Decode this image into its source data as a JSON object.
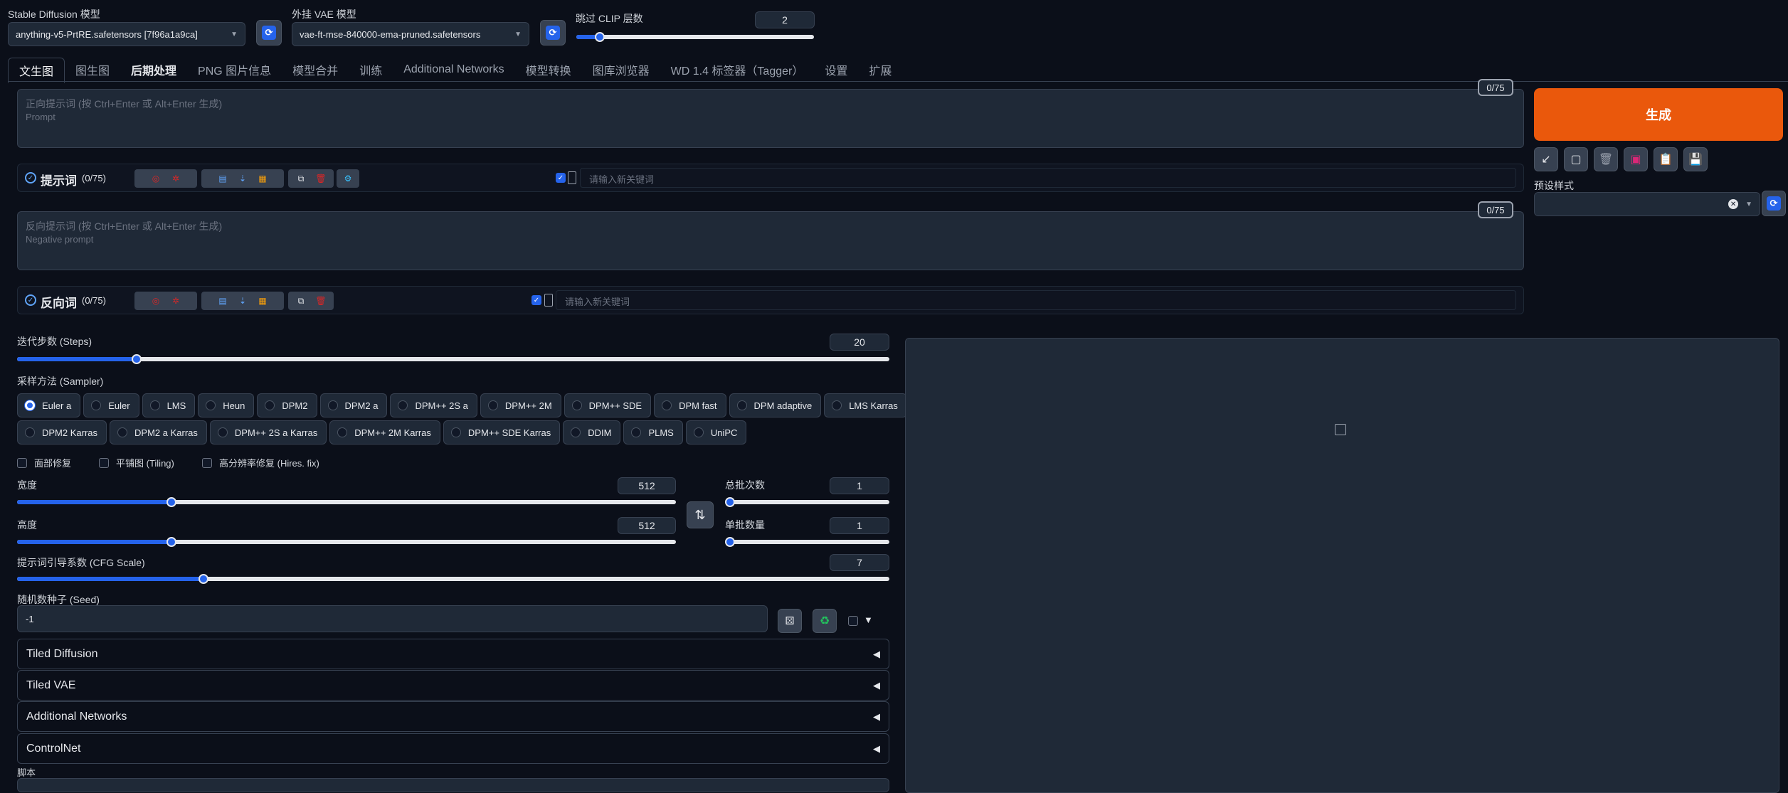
{
  "top": {
    "sd_model_label": "Stable Diffusion 模型",
    "sd_model_value": "anything-v5-PrtRE.safetensors [7f96a1a9ca]",
    "vae_label": "外挂 VAE 模型",
    "vae_value": "vae-ft-mse-840000-ema-pruned.safetensors",
    "clip_label": "跳过 CLIP 层数",
    "clip_value": "2",
    "clip_fraction": 0.08
  },
  "tabs": [
    "文生图",
    "图生图",
    "后期处理",
    "PNG 图片信息",
    "模型合并",
    "训练",
    "Additional Networks",
    "模型转换",
    "图库浏览器",
    "WD 1.4 标签器（Tagger）",
    "设置",
    "扩展"
  ],
  "prompt": {
    "counter": "0/75",
    "placeholder_line1": "正向提示词 (按 Ctrl+Enter 或 Alt+Enter 生成)",
    "placeholder_line2": "Prompt"
  },
  "prompt_tags": {
    "title": "提示词",
    "count": "(0/75)",
    "keyword_placeholder": "请输入新关键词"
  },
  "negative": {
    "counter": "0/75",
    "placeholder_line1": "反向提示词 (按 Ctrl+Enter 或 Alt+Enter 生成)",
    "placeholder_line2": "Negative prompt"
  },
  "negative_tags": {
    "title": "反向词",
    "count": "(0/75)",
    "keyword_placeholder": "请输入新关键词"
  },
  "generate": {
    "label": "生成",
    "preset_label": "预设样式"
  },
  "steps": {
    "label": "迭代步数 (Steps)",
    "value": "20",
    "fraction": 0.133
  },
  "sampler": {
    "label": "采样方法 (Sampler)",
    "selected": "Euler a",
    "row1": [
      "Euler a",
      "Euler",
      "LMS",
      "Heun",
      "DPM2",
      "DPM2 a",
      "DPM++ 2S a",
      "DPM++ 2M",
      "DPM++ SDE",
      "DPM fast",
      "DPM adaptive",
      "LMS Karras"
    ],
    "row2": [
      "DPM2 Karras",
      "DPM2 a Karras",
      "DPM++ 2S a Karras",
      "DPM++ 2M Karras",
      "DPM++ SDE Karras",
      "DDIM",
      "PLMS",
      "UniPC"
    ]
  },
  "options": {
    "face_restore": "面部修复",
    "tiling": "平铺图 (Tiling)",
    "hires": "高分辨率修复 (Hires. fix)"
  },
  "width": {
    "label": "宽度",
    "value": "512",
    "fraction": 0.23
  },
  "height": {
    "label": "高度",
    "value": "512",
    "fraction": 0.23
  },
  "batch_count": {
    "label": "总批次数",
    "value": "1",
    "fraction": 0.0
  },
  "batch_size": {
    "label": "单批数量",
    "value": "1",
    "fraction": 0.0
  },
  "cfg": {
    "label": "提示词引导系数 (CFG Scale)",
    "value": "7",
    "fraction": 0.21
  },
  "seed": {
    "label": "随机数种子 (Seed)",
    "value": "-1"
  },
  "accordions": [
    "Tiled Diffusion",
    "Tiled VAE",
    "Additional Networks",
    "ControlNet"
  ],
  "script_label": "脚本",
  "colors": {
    "accent": "#2563eb",
    "generate": "#ea580c",
    "bg": "#0b0f19",
    "panel": "#1f2937"
  }
}
